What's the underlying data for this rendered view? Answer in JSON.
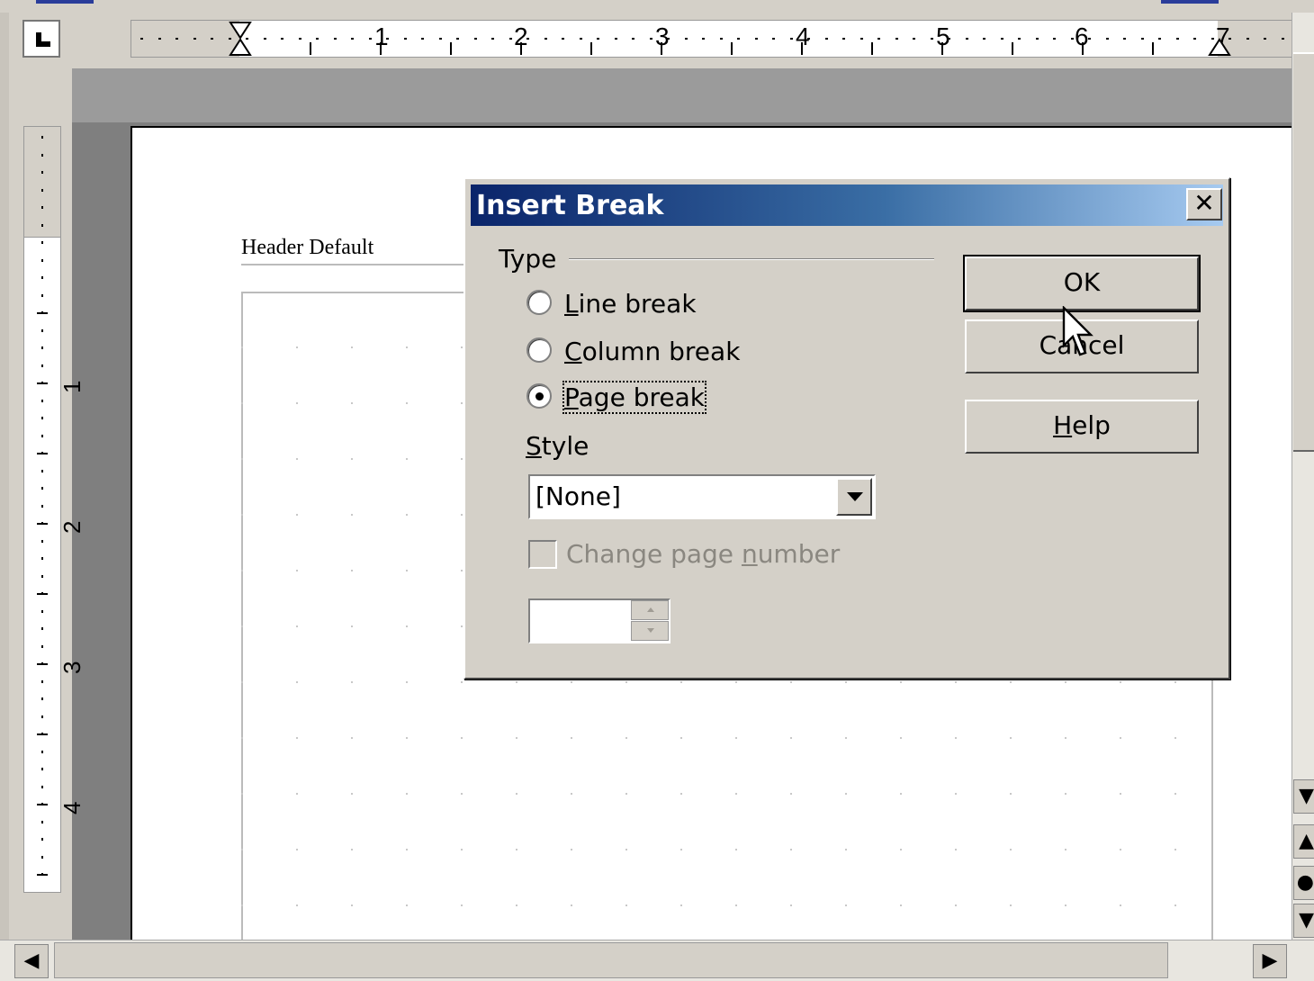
{
  "ruler": {
    "horizontal_numbers": [
      "1",
      "2",
      "3",
      "4",
      "5",
      "6",
      "7"
    ],
    "vertical_numbers": [
      "1",
      "2",
      "3",
      "4"
    ]
  },
  "document": {
    "header_label": "Header Default"
  },
  "dialog": {
    "title": "Insert Break",
    "close_glyph": "✕",
    "type_section": {
      "label": "Type",
      "options": [
        {
          "first": "L",
          "rest": "ine break",
          "checked": false
        },
        {
          "first": "C",
          "rest": "olumn break",
          "checked": false
        },
        {
          "first": "P",
          "rest": "age break",
          "checked": true
        }
      ]
    },
    "style": {
      "label_first": "S",
      "label_rest": "tyle",
      "selected": "[None]"
    },
    "change_page_number": {
      "label_pre": "Change page ",
      "label_under": "n",
      "label_post": "umber",
      "checked": false,
      "enabled": false
    },
    "page_number_value": "",
    "buttons": {
      "ok": "OK",
      "cancel": "Cancel",
      "help_first": "H",
      "help_rest": "elp"
    }
  },
  "colors": {
    "title_gradient_start": "#0a246a",
    "title_gradient_end": "#a6caf0",
    "dialog_bg": "#d4d0c8"
  }
}
